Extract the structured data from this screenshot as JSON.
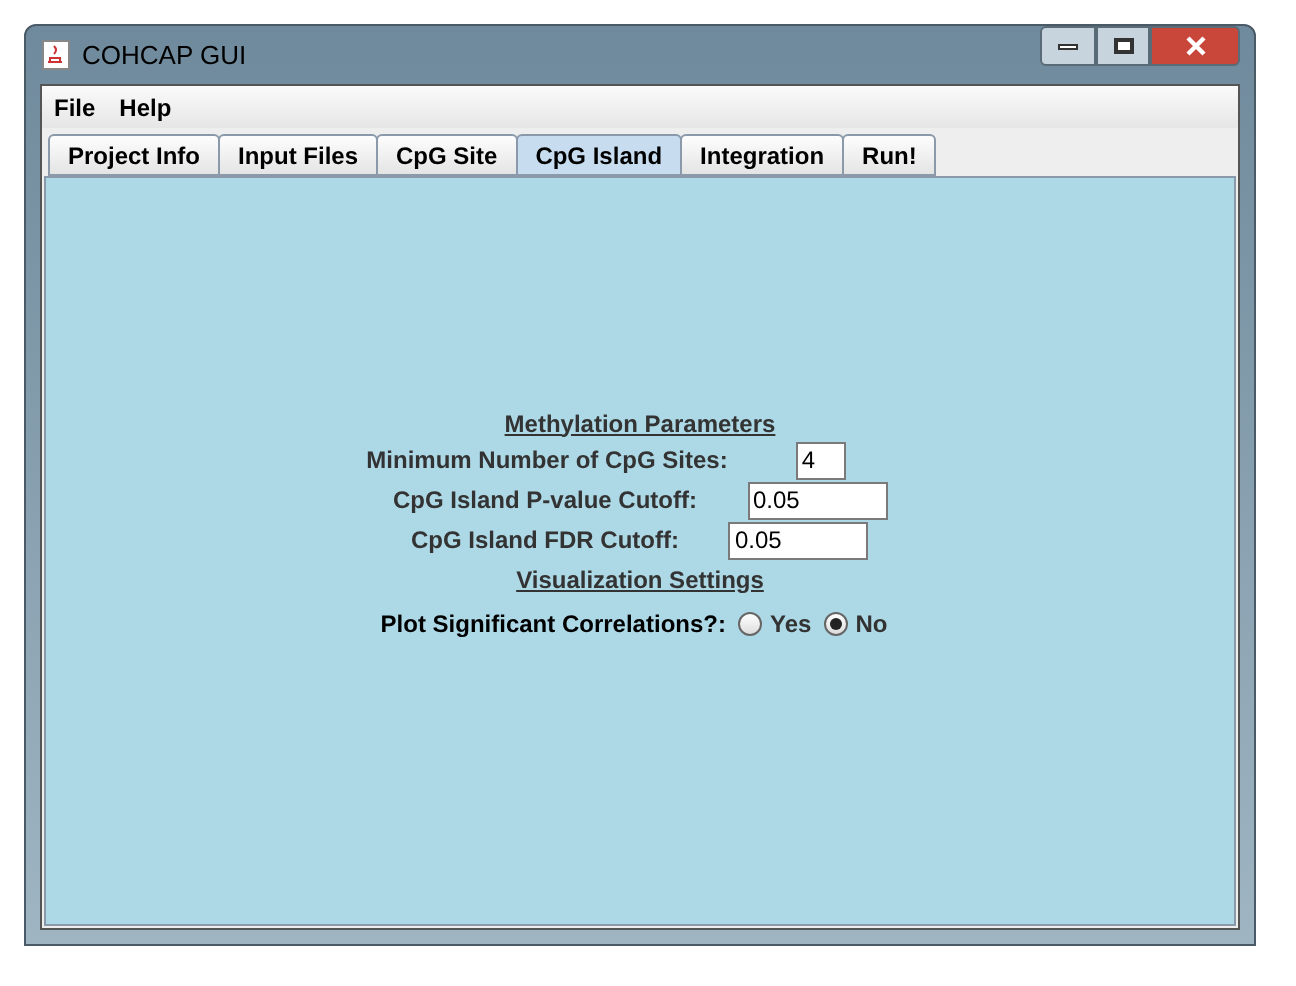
{
  "window": {
    "title": "COHCAP GUI"
  },
  "menu": [
    "File",
    "Help"
  ],
  "tabs": [
    {
      "label": "Project Info",
      "selected": false
    },
    {
      "label": "Input Files",
      "selected": false
    },
    {
      "label": "CpG Site",
      "selected": false
    },
    {
      "label": "CpG Island",
      "selected": true
    },
    {
      "label": "Integration",
      "selected": false
    },
    {
      "label": "Run!",
      "selected": false
    }
  ],
  "methylation": {
    "heading": "Methylation Parameters",
    "fields": [
      {
        "label": "Minimum Number of CpG Sites:",
        "value": "4",
        "kind": "short"
      },
      {
        "label": "CpG Island P-value Cutoff:",
        "value": "0.05",
        "kind": "long"
      },
      {
        "label": "CpG Island FDR Cutoff:",
        "value": "0.05",
        "kind": "long"
      }
    ]
  },
  "visualization": {
    "heading": "Visualization Settings",
    "question": "Plot Significant Correlations?:",
    "options": [
      {
        "label": "Yes",
        "selected": false
      },
      {
        "label": "No",
        "selected": true
      }
    ]
  }
}
